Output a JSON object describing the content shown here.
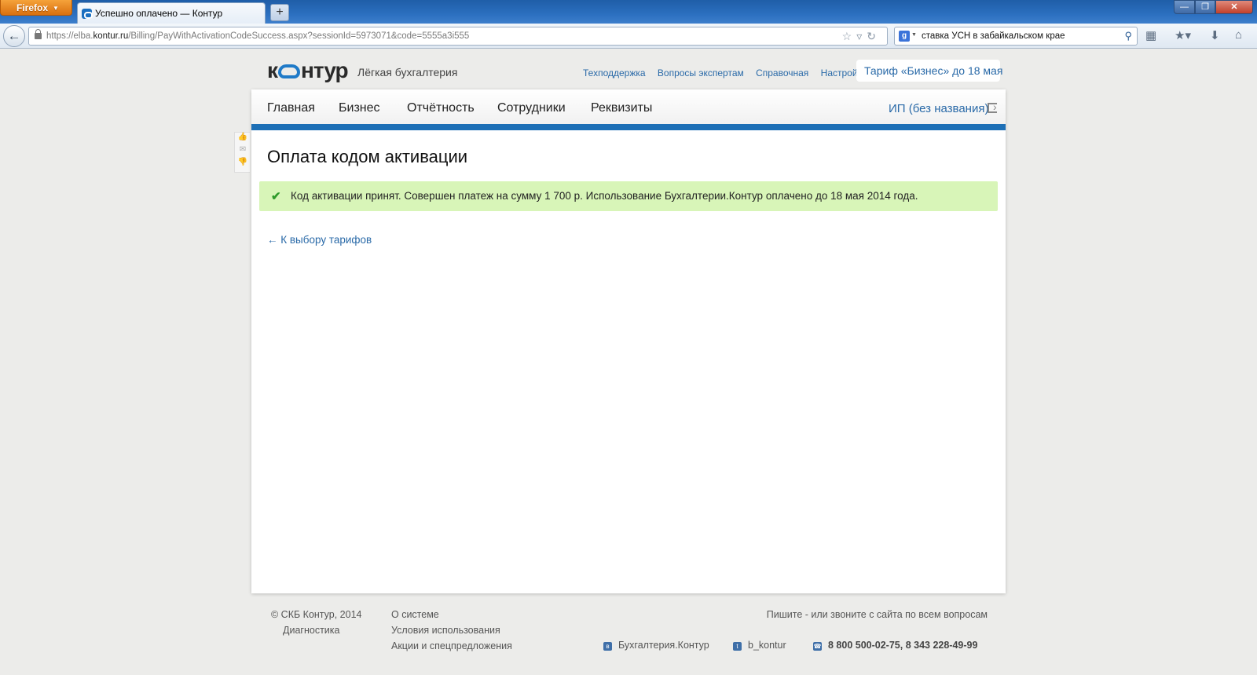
{
  "browser": {
    "app_button": "Firefox",
    "tab_title": "Успешно оплачено — Контур",
    "new_tab": "+",
    "url_prefix": "https://elba.",
    "url_host": "kontur.ru",
    "url_path": "/Billing/PayWithActivationCodeSuccess.aspx?sessionId=5973071&code=5555a3i555",
    "search_query": "ставка УСН в забайкальском крае",
    "window_controls": {
      "minimize": "—",
      "maximize": "❐",
      "close": "✕"
    },
    "icons": [
      "back-arrow-icon",
      "lock-icon",
      "bookmark-star-icon",
      "reload-icon",
      "google-icon",
      "search-icon",
      "addon-icon",
      "bookmarks-icon",
      "download-icon",
      "home-icon"
    ]
  },
  "header": {
    "logo_left": "к",
    "logo_right": "нтур",
    "tagline": "Лёгкая бухгалтерия",
    "links": [
      "Техподдержка",
      "Вопросы экспертам",
      "Справочная",
      "Настройка"
    ],
    "tariff": "Тариф «Бизнес» до 18 мая"
  },
  "menu": {
    "items": [
      "Главная",
      "Бизнес",
      "Отчётность",
      "Сотрудники",
      "Реквизиты"
    ],
    "org": "ИП (без названия)"
  },
  "main": {
    "title": "Оплата кодом активации",
    "success_message": "Код активации принят. Совершен платеж на сумму 1 700 р. Использование Бухгалтерии.Контур оплачено до 18 мая 2014 года.",
    "back_link": "← К выбору тарифов"
  },
  "footer": {
    "copyright": "© СКБ Контур, 2014",
    "diagnostics": "Диагностика",
    "links": [
      "О системе",
      "Условия использования",
      "Акции и спецпредложения"
    ],
    "contact_note": "Пишите - или звоните с сайта по всем вопросам",
    "vk": "Бухгалтерия.Контур",
    "twitter": "b_kontur",
    "phones": "8 800 500-02-75, 8 343 228-49-99"
  },
  "colors": {
    "accent": "#1d6fb6",
    "link": "#2a6aa8",
    "success_bg": "#d8f5b8"
  }
}
